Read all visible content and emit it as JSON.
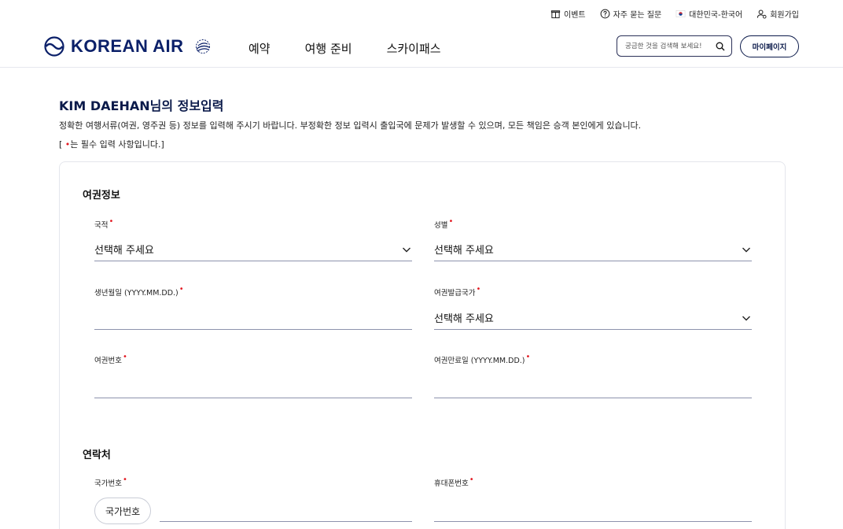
{
  "utility_bar": {
    "event": "이벤트",
    "faq": "자주 묻는 질문",
    "locale": "대한민국-한국어",
    "signup": "회원가입"
  },
  "header": {
    "logo_text": "KOREAN AIR",
    "nav": [
      "예약",
      "여행 준비",
      "스카이패스"
    ],
    "search_placeholder": "궁금한 것을 검색해 보세요!",
    "mypage": "마이페이지"
  },
  "page": {
    "title": "KIM DAEHAN님의 정보입력",
    "description": "정확한 여행서류(여권, 영주권 등) 정보를 입력해 주시기 바랍니다. 부정확한 정보 입력시 출입국에 문제가 발생할 수 있으며, 모든 책임은 승객 본인에게 있습니다.",
    "note_prefix": "[ ",
    "note_dot": "•",
    "note_suffix": "는 필수 입력 사항입니다.]"
  },
  "passport_section": {
    "title": "여권정보",
    "nationality": {
      "label": "국적",
      "value": "선택해 주세요"
    },
    "gender": {
      "label": "성별",
      "value": "선택해 주세요"
    },
    "birthdate": {
      "label": "생년월일 (YYYY.MM.DD.)",
      "value": ""
    },
    "issuing_country": {
      "label": "여권발급국가",
      "value": "선택해 주세요"
    },
    "passport_number": {
      "label": "여권번호",
      "value": ""
    },
    "expiry_date": {
      "label": "여권만료일 (YYYY.MM.DD.)",
      "value": ""
    }
  },
  "contact_section": {
    "title": "연락처",
    "country_code": {
      "label": "국가번호",
      "chip": "국가번호",
      "value": ""
    },
    "mobile": {
      "label": "휴대폰번호",
      "value": ""
    }
  },
  "required_mark": "•",
  "colors": {
    "brand_navy": "#0b1a4a",
    "required_red": "#e31b23",
    "line": "#8d93ad"
  }
}
